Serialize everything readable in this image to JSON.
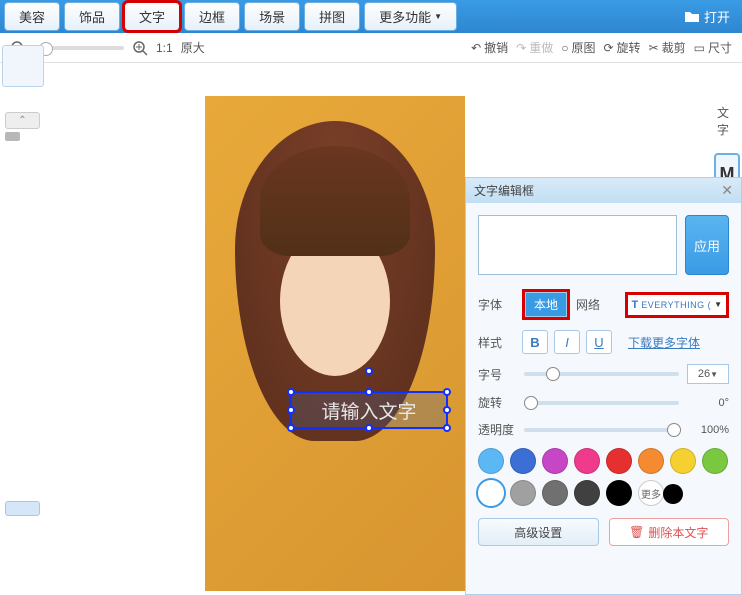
{
  "toolbar": {
    "tabs": [
      "美容",
      "饰品",
      "文字",
      "边框",
      "场景",
      "拼图"
    ],
    "more": "更多功能",
    "open": "打开"
  },
  "second": {
    "ratio": "1:1",
    "original_size": "原大",
    "undo": "撤销",
    "redo": "重做",
    "original_img": "原图",
    "rotate": "旋转",
    "crop": "裁剪",
    "ruler": "尺寸"
  },
  "right": {
    "text_tab": "文字",
    "m_label": "M"
  },
  "textbox": {
    "placeholder": "请输入文字"
  },
  "panel": {
    "title": "文字编辑框",
    "apply": "应用",
    "font_label": "字体",
    "local": "本地",
    "network": "网络",
    "font_name": "EVERYTHING (",
    "style_label": "样式",
    "more_fonts": "下载更多字体",
    "size_label": "字号",
    "size_value": "26",
    "rotate_label": "旋转",
    "rotate_value": "0°",
    "opacity_label": "透明度",
    "opacity_value": "100%",
    "colors": [
      "#5cb8f5",
      "#3b6fd6",
      "#c646c6",
      "#f03a8c",
      "#e63030",
      "#f58a30",
      "#f5d030",
      "#7ac840",
      "#ffffff",
      "#a0a0a0",
      "#707070",
      "#404040",
      "#000000"
    ],
    "more_colors": "更多",
    "advanced": "高级设置",
    "delete": "删除本文字"
  }
}
